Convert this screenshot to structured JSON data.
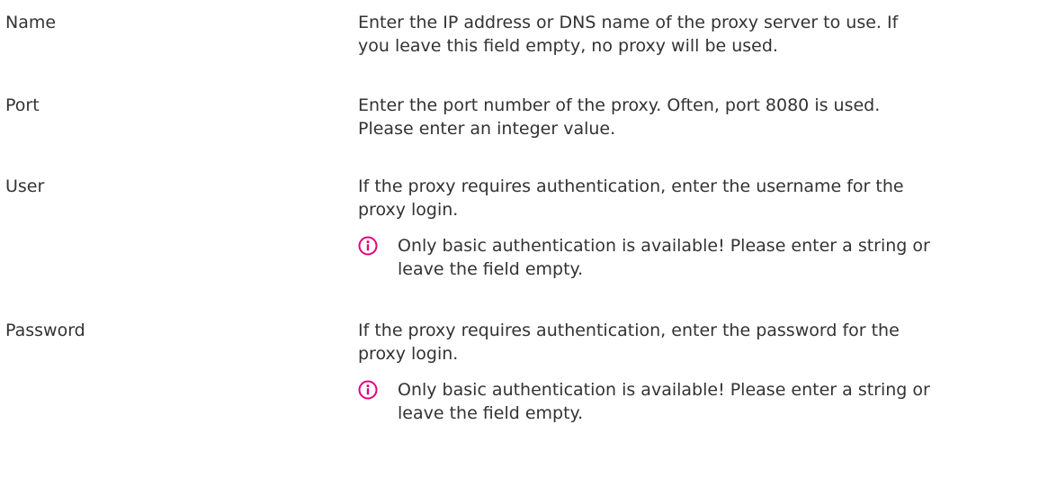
{
  "fields": [
    {
      "label": "Name",
      "description_lines": [
        "Enter the IP address or DNS name of the proxy server to use. If",
        "you leave this field empty, no proxy will be used."
      ]
    },
    {
      "label": "Port",
      "description_lines": [
        "Enter the port number of the proxy. Often, port 8080 is used.",
        "Please enter an integer value."
      ]
    },
    {
      "label": "User",
      "description_lines": [
        "If the proxy requires authentication, enter the username for the",
        "proxy login."
      ],
      "note_lines": [
        "Only basic authentication is available! Please enter a string or",
        "leave the field empty."
      ],
      "note_icon": "info-icon"
    },
    {
      "label": "Password",
      "description_lines": [
        "If the proxy requires authentication, enter the password for the",
        "proxy login."
      ],
      "note_lines": [
        "Only basic authentication is available! Please enter a string or",
        "leave the field empty."
      ],
      "note_icon": "info-icon"
    }
  ],
  "colors": {
    "text": "#333333",
    "note_icon": "#e5007e",
    "background": "#ffffff"
  }
}
